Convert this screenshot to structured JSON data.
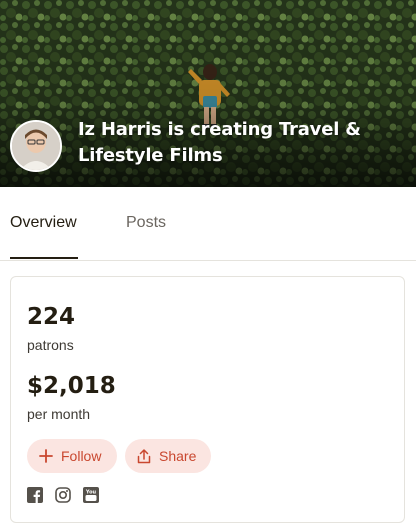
{
  "hero": {
    "title": "Iz Harris is creating Travel & Lifestyle Films"
  },
  "tabs": [
    {
      "label": "Overview",
      "active": true
    },
    {
      "label": "Posts",
      "active": false
    }
  ],
  "stats": {
    "patrons_value": "224",
    "patrons_label": "patrons",
    "earnings_value": "$2,018",
    "earnings_label": "per month"
  },
  "actions": {
    "follow_label": "Follow",
    "share_label": "Share"
  },
  "social": [
    "facebook-icon",
    "instagram-icon",
    "youtube-icon"
  ],
  "colors": {
    "accent": "#c9472f",
    "accent_bg": "#fbe5e1",
    "text": "#241e12",
    "muted": "#6b6660"
  }
}
